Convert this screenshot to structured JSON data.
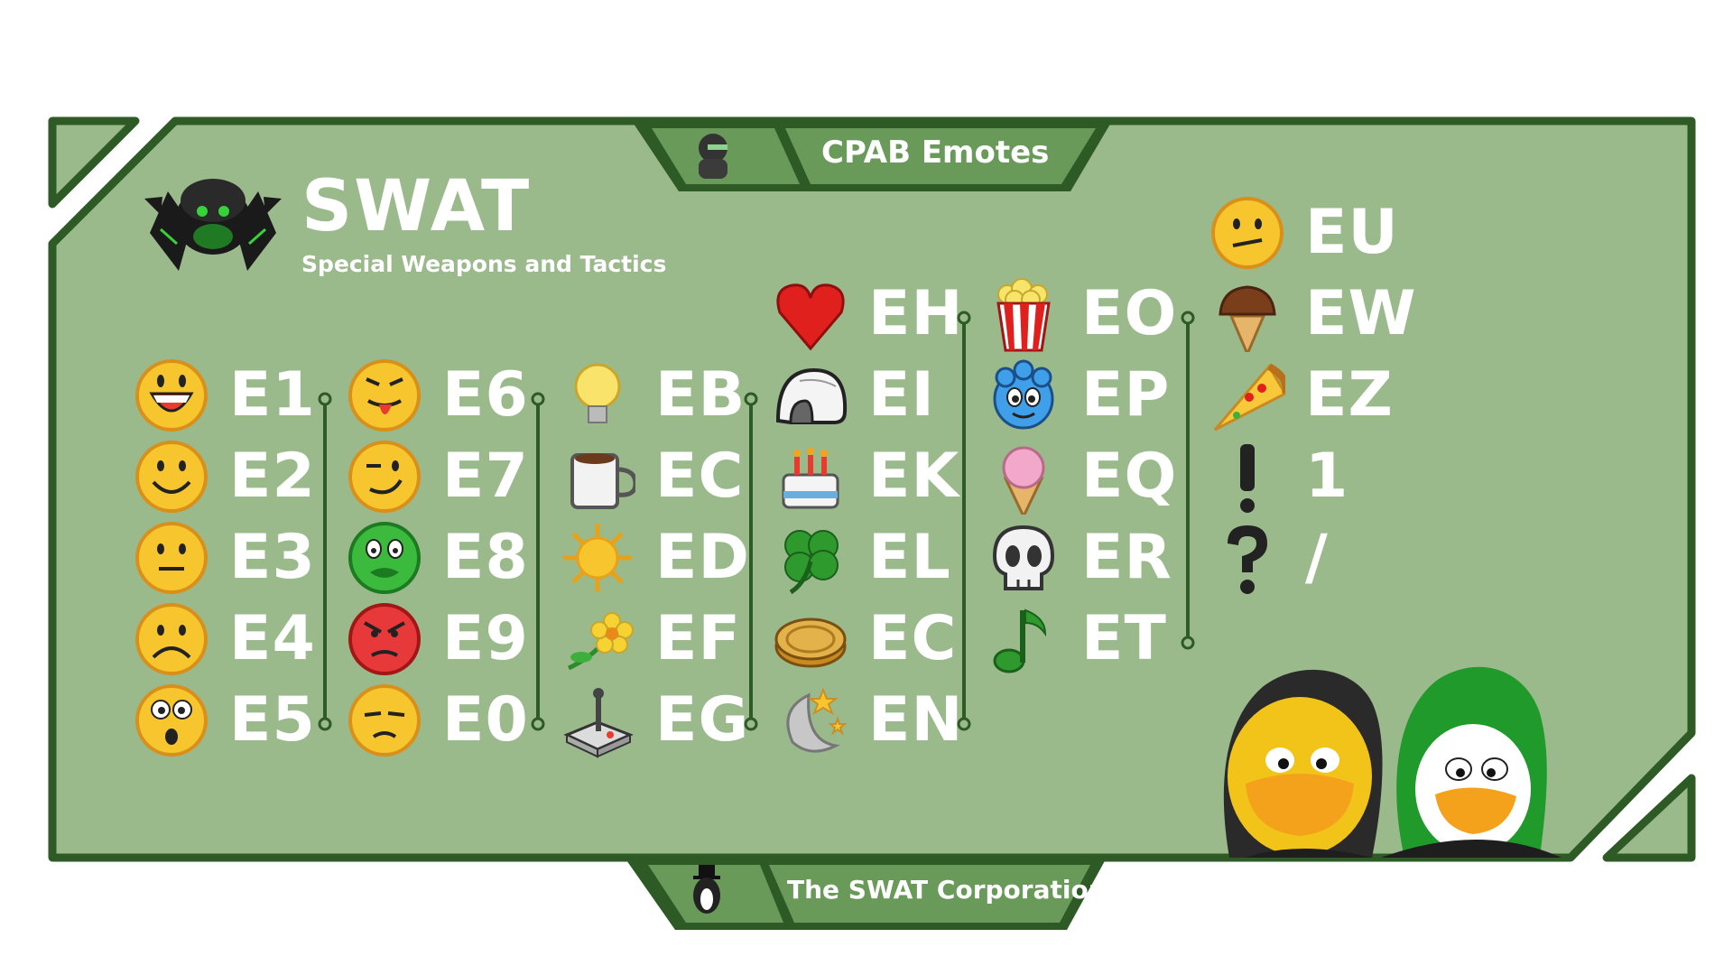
{
  "brand": {
    "title": "SWAT",
    "subtitle": "Special Weapons and Tactics"
  },
  "header_tab": {
    "label": "CPAB Emotes"
  },
  "footer_tab": {
    "label": "The SWAT Corporation"
  },
  "colors": {
    "panel": "#9bba8c",
    "border": "#2d5a25",
    "tab": "#6a9a5a",
    "text": "#ffffff"
  },
  "columns": [
    {
      "items": [
        {
          "icon": "laughing-face-icon",
          "code": "E1"
        },
        {
          "icon": "smiling-face-icon",
          "code": "E2"
        },
        {
          "icon": "neutral-face-icon",
          "code": "E3"
        },
        {
          "icon": "sad-face-icon",
          "code": "E4"
        },
        {
          "icon": "surprised-face-icon",
          "code": "E5"
        }
      ]
    },
    {
      "items": [
        {
          "icon": "tongue-out-face-icon",
          "code": "E6"
        },
        {
          "icon": "winking-face-icon",
          "code": "E7"
        },
        {
          "icon": "sick-green-face-icon",
          "code": "E8"
        },
        {
          "icon": "angry-red-face-icon",
          "code": "E9"
        },
        {
          "icon": "sad-down-face-icon",
          "code": "E0"
        }
      ]
    },
    {
      "items": [
        {
          "icon": "lightbulb-icon",
          "code": "EB"
        },
        {
          "icon": "coffee-mug-icon",
          "code": "EC"
        },
        {
          "icon": "sun-icon",
          "code": "ED"
        },
        {
          "icon": "flower-icon",
          "code": "EF"
        },
        {
          "icon": "joystick-icon",
          "code": "EG"
        }
      ]
    },
    {
      "items": [
        {
          "icon": "heart-icon",
          "code": "EH"
        },
        {
          "icon": "igloo-icon",
          "code": "EI"
        },
        {
          "icon": "birthday-cake-icon",
          "code": "EK"
        },
        {
          "icon": "clover-icon",
          "code": "EL"
        },
        {
          "icon": "coin-icon",
          "code": "EC"
        },
        {
          "icon": "moon-stars-icon",
          "code": "EN"
        }
      ]
    },
    {
      "items": [
        {
          "icon": "popcorn-icon",
          "code": "EO"
        },
        {
          "icon": "blue-puffle-icon",
          "code": "EP"
        },
        {
          "icon": "ice-cream-cone-icon",
          "code": "EQ"
        },
        {
          "icon": "skull-icon",
          "code": "ER"
        },
        {
          "icon": "music-note-icon",
          "code": "ET"
        }
      ]
    },
    {
      "items": [
        {
          "icon": "meh-face-icon",
          "code": "EU"
        },
        {
          "icon": "chocolate-cone-icon",
          "code": "EW"
        },
        {
          "icon": "pizza-slice-icon",
          "code": "EZ"
        },
        {
          "icon": "exclamation-icon",
          "code": "1"
        },
        {
          "icon": "question-icon",
          "code": "/"
        }
      ]
    }
  ]
}
